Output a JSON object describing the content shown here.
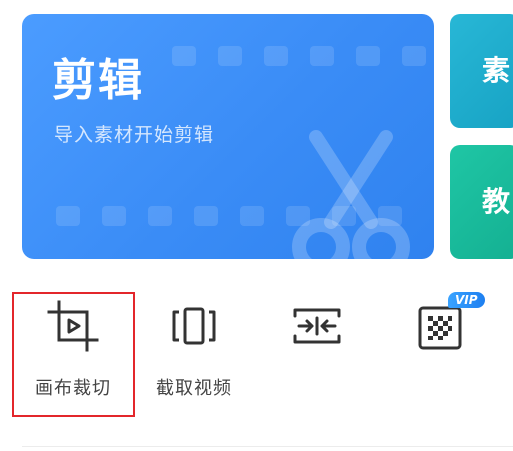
{
  "main_card": {
    "title": "剪辑",
    "subtitle": "导入素材开始剪辑",
    "color": "#3a8cf6"
  },
  "side_cards": [
    {
      "label": "素",
      "color": "#1aa8c9"
    },
    {
      "label": "教",
      "color": "#18b898"
    }
  ],
  "tools": [
    {
      "label": "画布裁切",
      "icon": "canvas-crop-icon"
    },
    {
      "label": "截取视频",
      "icon": "trim-video-icon"
    },
    {
      "label": "",
      "icon": "merge-icon"
    },
    {
      "label": "",
      "icon": "mosaic-icon"
    }
  ],
  "vip_badge": "VIP",
  "highlight_color": "#e3262b"
}
